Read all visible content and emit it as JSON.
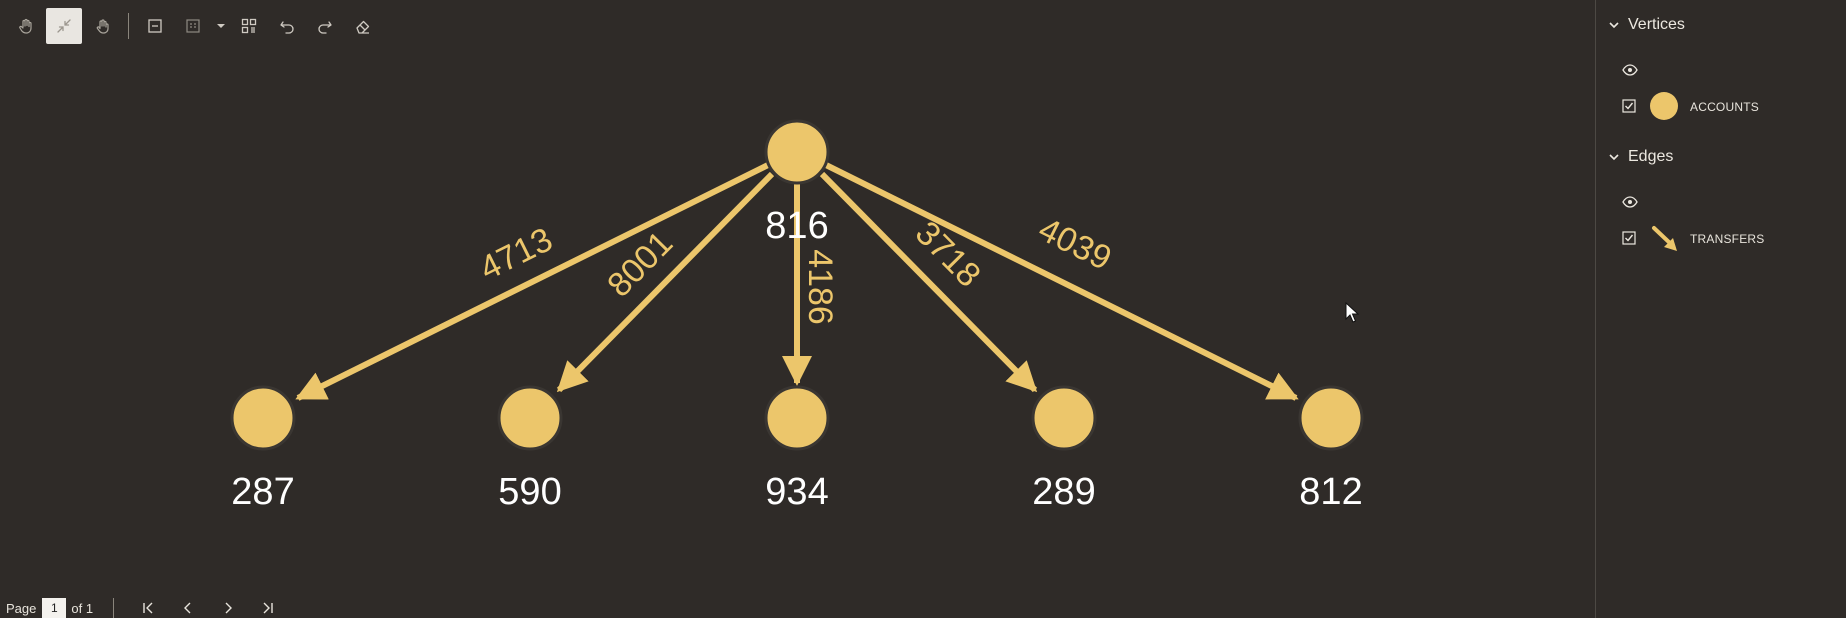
{
  "colors": {
    "background": "#2f2b28",
    "node": "#ecc66b",
    "edge": "#ecc66b",
    "edge_label": "#ecc66b",
    "node_label": "#ffffff"
  },
  "toolbar": {
    "buttons": [
      {
        "name": "pan-hand-icon"
      },
      {
        "name": "collapse-icon",
        "active": true
      },
      {
        "name": "select-hand-icon"
      },
      {
        "name": "expand-box-icon"
      },
      {
        "name": "grid-select-icon"
      },
      {
        "name": "layout-icon"
      },
      {
        "name": "undo-icon"
      },
      {
        "name": "redo-icon"
      },
      {
        "name": "eraser-icon"
      }
    ]
  },
  "graph": {
    "nodes": [
      {
        "id": "n816",
        "label": "816"
      },
      {
        "id": "n287",
        "label": "287"
      },
      {
        "id": "n590",
        "label": "590"
      },
      {
        "id": "n934",
        "label": "934"
      },
      {
        "id": "n289",
        "label": "289"
      },
      {
        "id": "n812",
        "label": "812"
      }
    ],
    "edges": [
      {
        "from": "n816",
        "to": "n287",
        "label": "4713"
      },
      {
        "from": "n816",
        "to": "n590",
        "label": "8001"
      },
      {
        "from": "n816",
        "to": "n934",
        "label": "4186"
      },
      {
        "from": "n816",
        "to": "n289",
        "label": "3718"
      },
      {
        "from": "n816",
        "to": "n812",
        "label": "4039"
      }
    ]
  },
  "legend": {
    "vertices": {
      "title": "Vertices",
      "item_label": "ACCOUNTS",
      "visible": true,
      "checked": true
    },
    "edges": {
      "title": "Edges",
      "item_label": "TRANSFERS",
      "visible": true,
      "checked": true
    }
  },
  "pager": {
    "page_label": "Page",
    "current_page": "1",
    "of_label": "of 1"
  }
}
